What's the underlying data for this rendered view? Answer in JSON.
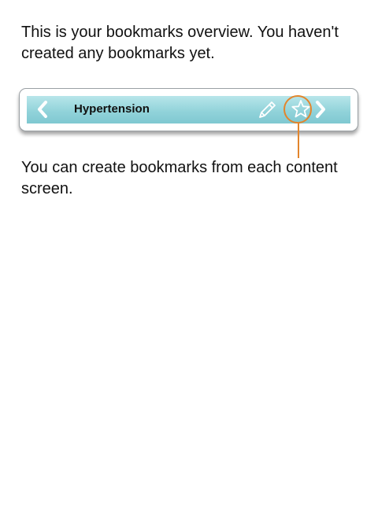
{
  "intro_text": "This is your bookmarks overview. You haven't created any bookmarks yet.",
  "toolbar": {
    "title": "Hypertension",
    "back_icon": "chevron-left-icon",
    "forward_icon": "chevron-right-icon",
    "edit_icon": "pencil-icon",
    "bookmark_icon": "star-icon"
  },
  "hint_text": "You can create bookmarks from each content screen.",
  "colors": {
    "toolbar_top": "#b8e6ea",
    "toolbar_bottom": "#7fc8d1",
    "highlight": "#e3852c",
    "icon": "#ffffff"
  }
}
